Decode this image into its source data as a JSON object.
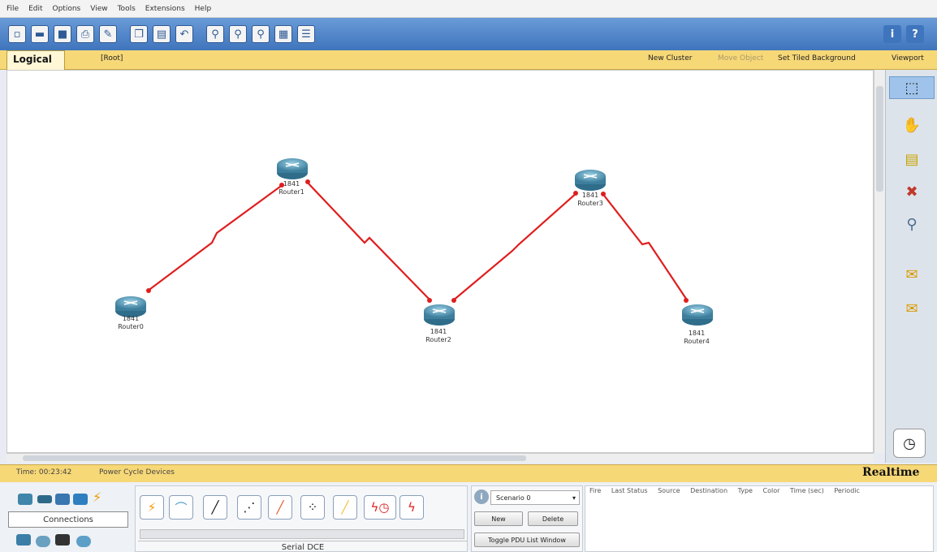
{
  "menu": [
    "File",
    "Edit",
    "Options",
    "View",
    "Tools",
    "Extensions",
    "Help"
  ],
  "toolbar": {
    "icons": [
      "new-file-icon",
      "open-folder-icon",
      "save-icon",
      "print-icon",
      "activity-wizard-icon",
      "copy-icon",
      "paste-icon",
      "undo-icon",
      "zoom-in-icon",
      "zoom-reset-icon",
      "zoom-out-icon",
      "palette-icon",
      "custom-device-icon"
    ],
    "right_icons": [
      "info-icon",
      "help-icon"
    ]
  },
  "workspace_bar": {
    "logical": "Logical",
    "root": "[Root]",
    "new_cluster": "New Cluster",
    "move_object": "Move Object",
    "set_tiled_background": "Set Tiled Background",
    "viewport": "Viewport"
  },
  "devices": [
    {
      "model": "1841",
      "name": "Router0"
    },
    {
      "model": "1841",
      "name": "Router1"
    },
    {
      "model": "1841",
      "name": "Router2"
    },
    {
      "model": "1841",
      "name": "Router3"
    },
    {
      "model": "1841",
      "name": "Router4"
    }
  ],
  "right_tools": [
    "select-icon",
    "hand-icon",
    "note-icon",
    "delete-icon",
    "inspect-icon",
    "simple-pdu-icon",
    "complex-pdu-icon"
  ],
  "status_bar": {
    "timer": "Time: 00:23:42",
    "power_cycle": "Power Cycle Devices",
    "realtime": "Realtime"
  },
  "bottom": {
    "category_label": "Connections",
    "selected_cable": "Serial DCE",
    "scenario": "Scenario 0",
    "new": "New",
    "delete": "Delete",
    "toggle_pdu": "Toggle PDU List Window",
    "pdu_columns": [
      "Fire",
      "Last Status",
      "Source",
      "Destination",
      "Type",
      "Color",
      "Time (sec)",
      "Periodic"
    ]
  },
  "colors": {
    "link": "#e01e1e",
    "toolbar": "#3f75bd",
    "yellow_bar": "#f7d877"
  }
}
